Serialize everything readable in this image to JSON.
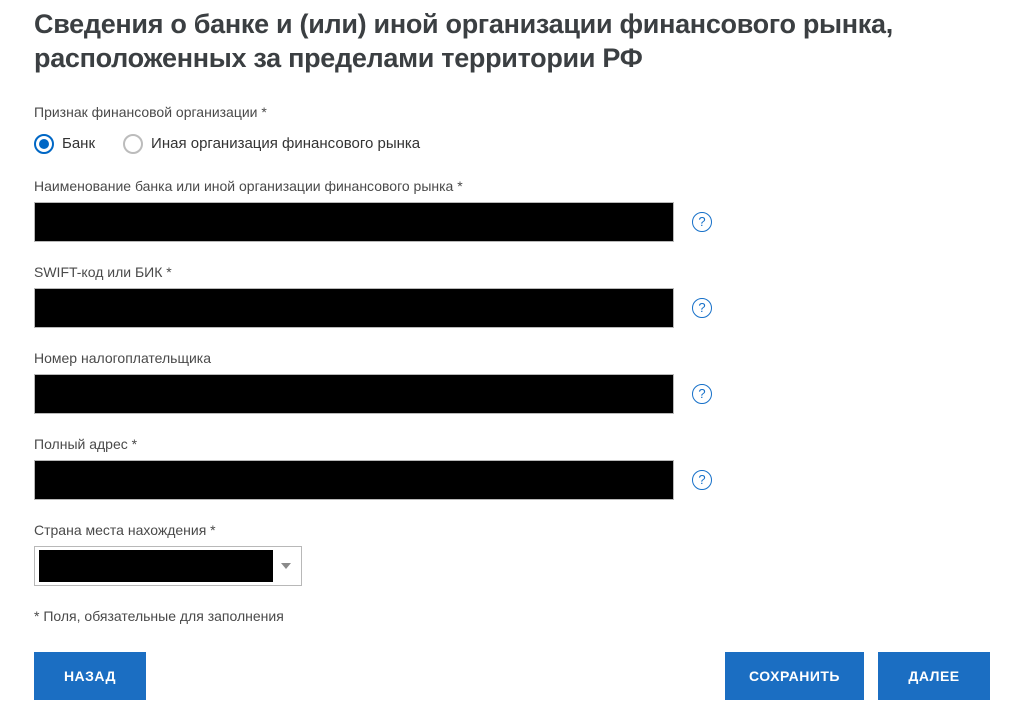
{
  "header": {
    "title": "Сведения о банке и (или) иной организации финансового рынка, расположенных за пределами территории РФ"
  },
  "form": {
    "orgTypeLabel": "Признак финансовой организации *",
    "radios": {
      "bank": "Банк",
      "other": "Иная организация финансового рынка"
    },
    "fields": {
      "nameLabel": "Наименование банка или иной организации финансового рынка *",
      "swiftLabel": "SWIFT-код или БИК *",
      "taxpayerLabel": "Номер налогоплательщика",
      "addressLabel": "Полный адрес *",
      "countryLabel": "Страна места нахождения *"
    },
    "helpGlyph": "?",
    "requiredNote": "* Поля, обязательные для заполнения"
  },
  "buttons": {
    "back": "НАЗАД",
    "save": "СОХРАНИТЬ",
    "next": "ДАЛЕЕ"
  }
}
